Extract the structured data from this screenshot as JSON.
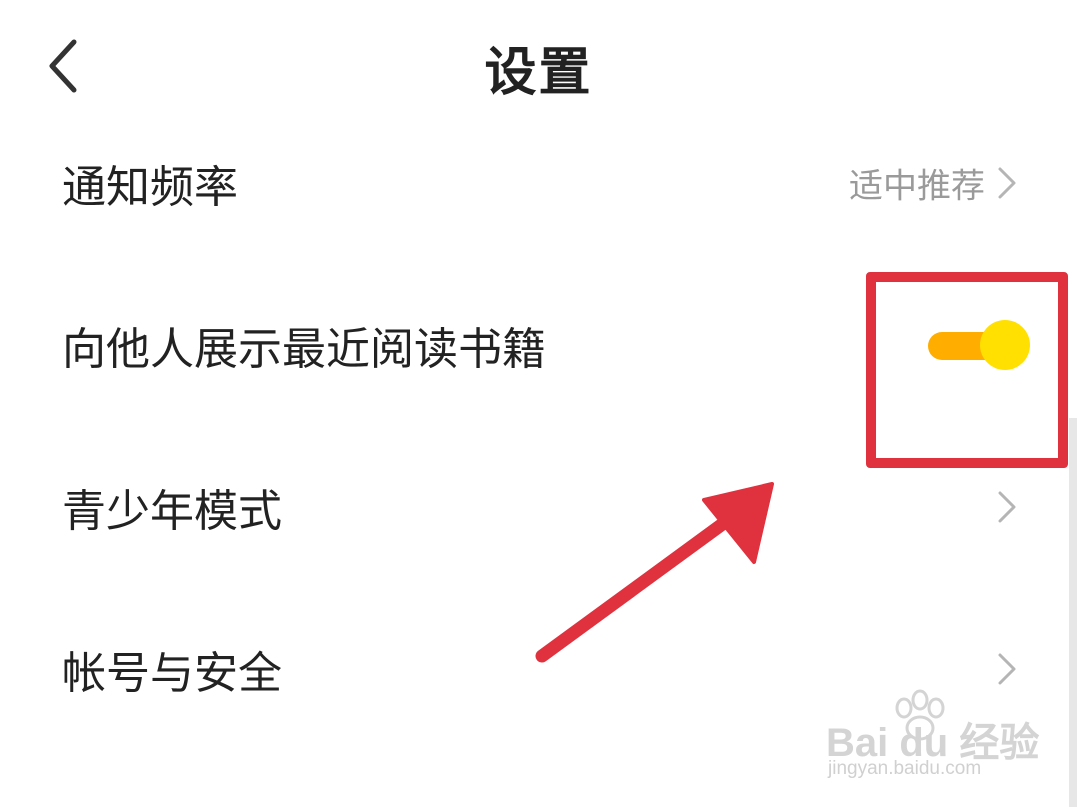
{
  "header": {
    "back_icon": "chevron-left-icon",
    "title": "设置"
  },
  "settings": {
    "rows": [
      {
        "label": "通知频率",
        "value": "适中推荐",
        "icon": "chevron-right-icon"
      },
      {
        "label": "向他人展示最近阅读书籍",
        "control": "toggle",
        "toggle_on": true
      },
      {
        "label": "青少年模式",
        "icon": "chevron-right-icon"
      },
      {
        "label": "帐号与安全",
        "icon": "chevron-right-icon"
      }
    ]
  },
  "annotation": {
    "highlight_color": "#e0323e",
    "arrow_color": "#e0323e"
  },
  "colors": {
    "toggle_track": "#ffae00",
    "toggle_knob": "#ffe000",
    "secondary_text": "#9a9a9a"
  },
  "watermark": {
    "main": "Bai du 经验",
    "sub": "jingyan.baidu.com"
  }
}
